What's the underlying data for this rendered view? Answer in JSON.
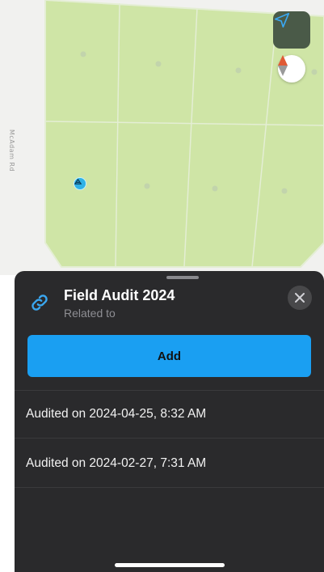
{
  "map": {
    "street_label": "McAdam Rd",
    "colors": {
      "parcel_fill": "#cfe5a6",
      "parcel_border": "#e4eed4",
      "background": "#f1f1ef",
      "marker": "#2fb2e6"
    },
    "icons": {
      "locate": "navigation-arrow-icon",
      "compass": "compass-icon",
      "marker": "parcel-marker-icon"
    }
  },
  "sheet": {
    "title": "Field Audit 2024",
    "subtitle": "Related to",
    "add_label": "Add",
    "items": [
      {
        "label": "Audited on 2024-04-25, 8:32 AM"
      },
      {
        "label": "Audited on 2024-02-27, 7:31 AM"
      }
    ],
    "colors": {
      "background": "#2a2a2c",
      "accent": "#1a9ff2"
    },
    "icons": {
      "link": "link-icon",
      "close": "close-icon"
    }
  }
}
